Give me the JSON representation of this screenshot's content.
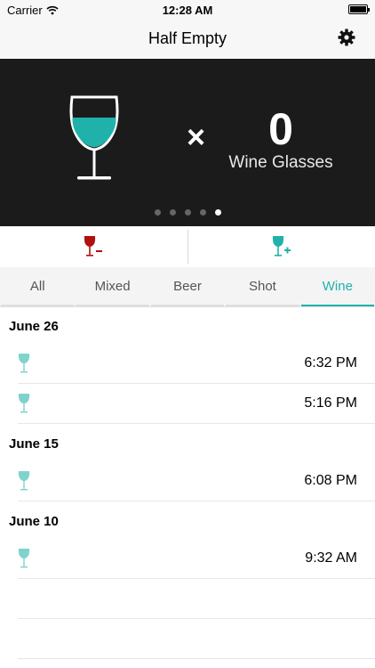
{
  "status": {
    "carrier": "Carrier",
    "time": "12:28 AM"
  },
  "nav": {
    "title": "Half Empty"
  },
  "hero": {
    "times": "×",
    "count": "0",
    "unit": "Wine Glasses",
    "page_count": 5,
    "active_page": 5
  },
  "colors": {
    "accent": "#20b2aa",
    "remove": "#b01010",
    "dark": "#1b1b1b"
  },
  "tabs": [
    {
      "label": "All"
    },
    {
      "label": "Mixed"
    },
    {
      "label": "Beer"
    },
    {
      "label": "Shot"
    },
    {
      "label": "Wine"
    }
  ],
  "active_tab": "Wine",
  "log": [
    {
      "date": "June 26",
      "entries": [
        "6:32 PM",
        "5:16 PM"
      ]
    },
    {
      "date": "June 15",
      "entries": [
        "6:08 PM"
      ]
    },
    {
      "date": "June 10",
      "entries": [
        "9:32 AM"
      ]
    }
  ]
}
